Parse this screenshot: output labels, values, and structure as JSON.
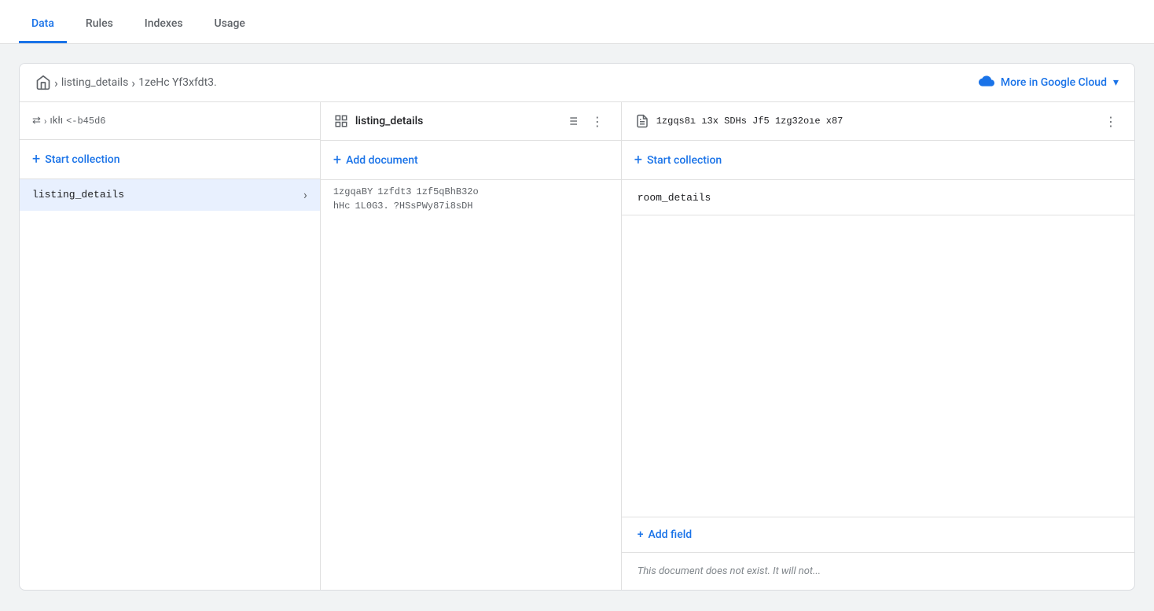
{
  "tabs": [
    {
      "label": "Data",
      "active": true
    },
    {
      "label": "Rules",
      "active": false
    },
    {
      "label": "Indexes",
      "active": false
    },
    {
      "label": "Usage",
      "active": false
    }
  ],
  "breadcrumb": {
    "home_icon": "🏠",
    "items": [
      {
        "label": "listing_details"
      },
      {
        "label": "1zeHc Yf3xfdt3."
      }
    ],
    "cloud_label": "More in Google Cloud",
    "chevron": "▾"
  },
  "left_column": {
    "nav_path": "⇄ > ıkłı <-b45d6",
    "start_collection_label": "Start collection",
    "items": [
      {
        "label": "listing_details",
        "selected": true
      }
    ]
  },
  "middle_column": {
    "icon": "📋",
    "title": "listing_details",
    "add_document_label": "Add document",
    "doc_ids_row1": [
      "1zgqaBY",
      "1zfdt3",
      "1zf5qBhB32o"
    ],
    "doc_ids_row2": [
      "hHc",
      "1L0G3.",
      "?HSsPWy87i8sDH"
    ]
  },
  "right_column": {
    "icon": "📄",
    "doc_path": "1zgqs8ı ı3x SDHs Jf5   1zg32oıe x87",
    "start_collection_label": "Start collection",
    "fields": [
      {
        "name": "room_details"
      }
    ],
    "add_field_label": "Add field",
    "not_exist_msg": "This document does not exist. It will not..."
  }
}
